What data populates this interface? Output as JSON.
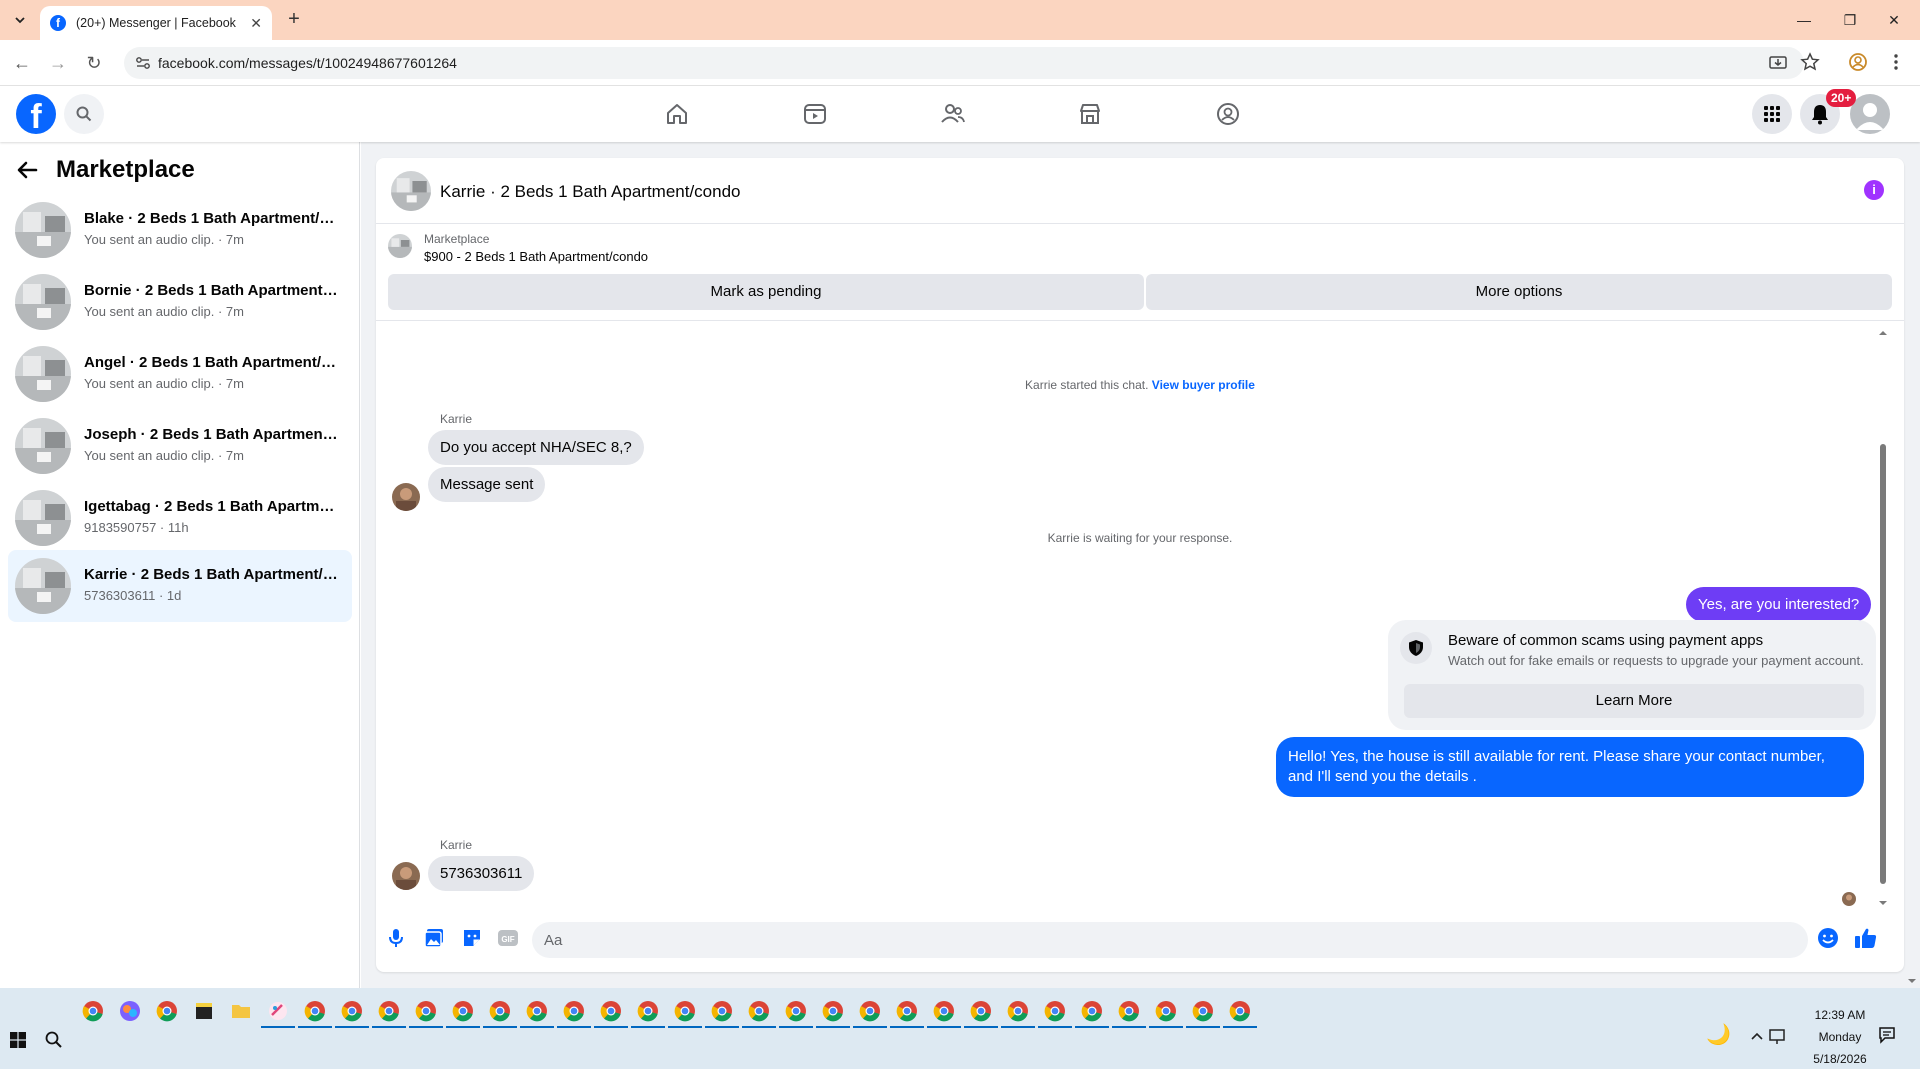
{
  "browser": {
    "tab_title": "(20+) Messenger | Facebook",
    "url": "facebook.com/messages/t/100249486776012​64",
    "url_display": "facebook.com/messages/t/10024948677601264"
  },
  "header": {
    "notif_badge": "20+"
  },
  "sidebar": {
    "title": "Marketplace",
    "conversations": [
      {
        "name": "Blake · 2 Beds 1 Bath Apartment/c...",
        "sub": "You sent an audio clip. · 7m"
      },
      {
        "name": "Bornie · 2 Beds 1 Bath Apartment/...",
        "sub": "You sent an audio clip. · 7m"
      },
      {
        "name": "Angel · 2 Beds 1 Bath Apartment/c...",
        "sub": "You sent an audio clip. · 7m"
      },
      {
        "name": "Joseph · 2 Beds 1 Bath Apartment/...",
        "sub": "You sent an audio clip. · 7m"
      },
      {
        "name": "Igettabag · 2 Beds 1 Bath Apartme...",
        "sub": "9183590757 · 11h"
      },
      {
        "name": "Karrie · 2 Beds 1 Bath Apartment/c...",
        "sub": "5736303611 · 1d"
      }
    ]
  },
  "chat": {
    "title": "Karrie · 2 Beds 1 Bath Apartment/condo",
    "listing_label": "Marketplace",
    "listing_title": "$900 - 2 Beds 1 Bath Apartment/condo",
    "mark_pending": "Mark as pending",
    "more_options": "More options",
    "started_text": "Karrie started this chat.",
    "view_profile": "View buyer profile",
    "sender_name": "Karrie",
    "msg_in_1": "Do you accept NHA/SEC 8,?",
    "msg_in_2": "Message sent",
    "waiting_text": "Karrie is waiting for your response.",
    "msg_out_1": "Yes, are you interested?",
    "scam_title": "Beware of common scams using payment apps",
    "scam_text": "Watch out for fake emails or requests to upgrade your payment account.",
    "learn_more": "Learn More",
    "msg_out_2": "Hello! Yes, the house is still available for rent. Please share your contact number, and I'll send you the details .",
    "sender_name_2": "Karrie",
    "msg_in_3": "5736303611",
    "input_placeholder": "Aa"
  },
  "taskbar": {
    "time": "12:39 AM",
    "day": "Monday",
    "date": "5/18/2026"
  },
  "colors": {
    "fb_blue": "#0866ff",
    "outgoing_purple": "#6e3df5",
    "badge_red": "#e41e3f",
    "tab_strip": "#fbd5c0"
  }
}
